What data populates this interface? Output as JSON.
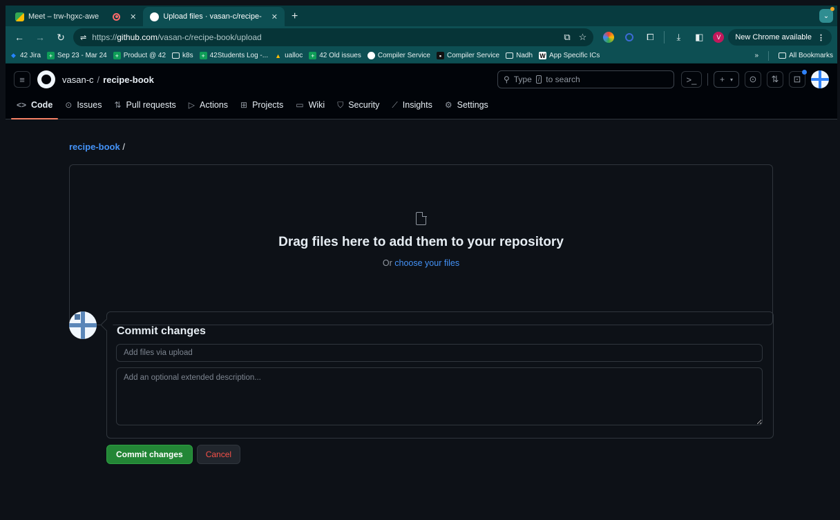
{
  "browser": {
    "tabs": [
      {
        "title": "Meet – trw-hgxc-awe",
        "active": false
      },
      {
        "title": "Upload files · vasan-c/recipe-",
        "active": true
      }
    ],
    "url_prefix": "https://",
    "url_host": "github.com",
    "url_path": "/vasan-c/recipe-book/upload",
    "new_chrome_label": "New Chrome available",
    "profile_initial": "V",
    "bookmarks": [
      {
        "label": "42 Jira",
        "icon": "jira-icon"
      },
      {
        "label": "Sep 23 - Mar 24",
        "icon": "sheets-icon"
      },
      {
        "label": "Product @ 42",
        "icon": "sheets-icon"
      },
      {
        "label": "k8s",
        "icon": "folder-icon"
      },
      {
        "label": "42Students Log -...",
        "icon": "sheets-icon"
      },
      {
        "label": "ualloc",
        "icon": "drive-icon"
      },
      {
        "label": "42 Old issues",
        "icon": "sheets-icon"
      },
      {
        "label": "Compiler Service",
        "icon": "github-icon"
      },
      {
        "label": "Compiler Service",
        "icon": "doc-icon"
      },
      {
        "label": "Nadh",
        "icon": "folder-icon"
      },
      {
        "label": "App Specific ICs",
        "icon": "wiki-icon"
      }
    ],
    "more_bookmarks": "»",
    "all_bookmarks": "All Bookmarks"
  },
  "github": {
    "owner": "vasan-c",
    "separator": "/",
    "repo": "recipe-book",
    "search_prefix": "Type",
    "search_key": "/",
    "search_suffix": "to search",
    "nav": [
      {
        "label": "Code",
        "icon": "<>",
        "selected": true
      },
      {
        "label": "Issues",
        "icon": "⊙",
        "selected": false
      },
      {
        "label": "Pull requests",
        "icon": "⇅",
        "selected": false
      },
      {
        "label": "Actions",
        "icon": "▷",
        "selected": false
      },
      {
        "label": "Projects",
        "icon": "⊞",
        "selected": false
      },
      {
        "label": "Wiki",
        "icon": "▭",
        "selected": false
      },
      {
        "label": "Security",
        "icon": "⛉",
        "selected": false
      },
      {
        "label": "Insights",
        "icon": "⟋",
        "selected": false
      },
      {
        "label": "Settings",
        "icon": "⚙",
        "selected": false
      }
    ]
  },
  "upload": {
    "path_repo": "recipe-book",
    "path_sep": "/",
    "drop_title": "Drag files here to add them to your repository",
    "drop_or": "Or",
    "drop_link": "choose your files"
  },
  "commit": {
    "title": "Commit changes",
    "summary_placeholder": "Add files via upload",
    "description_placeholder": "Add an optional extended description...",
    "commit_button": "Commit changes",
    "cancel_button": "Cancel"
  },
  "colors": {
    "accent": "#4493f8",
    "commit_green": "#238636",
    "cancel_red": "#f85149",
    "tab_underline": "#f78166",
    "chrome_theme": "#0d4f53"
  }
}
